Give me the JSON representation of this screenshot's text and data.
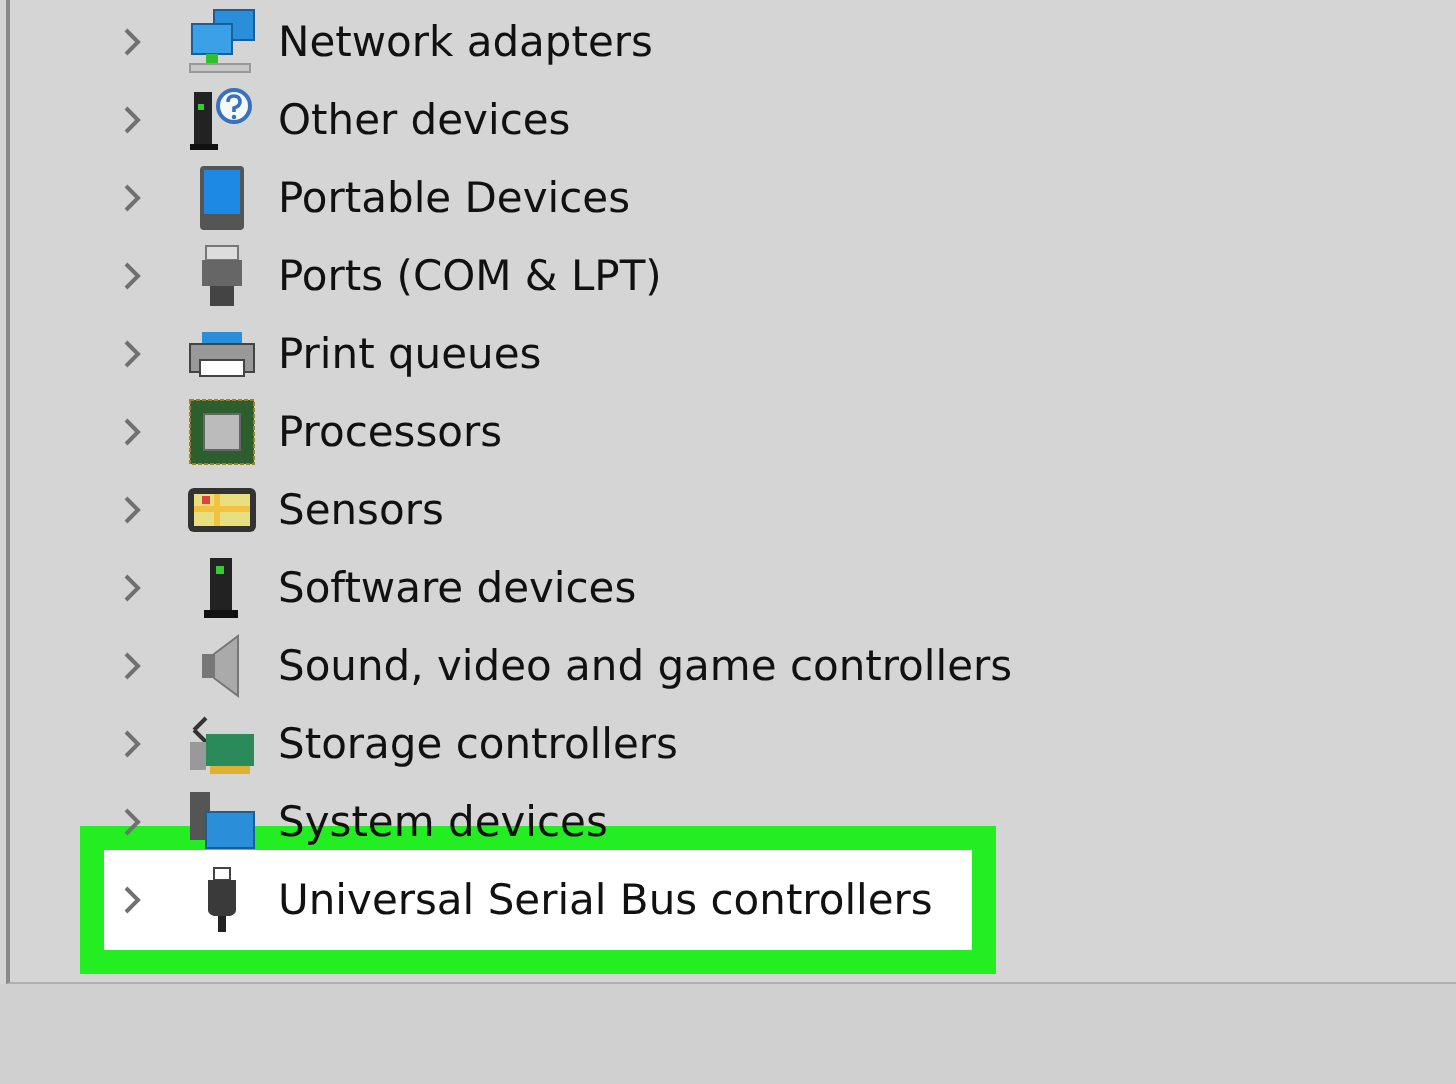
{
  "categories": [
    {
      "label": "Network adapters",
      "selected": false
    },
    {
      "label": "Other devices",
      "selected": false
    },
    {
      "label": "Portable Devices",
      "selected": false
    },
    {
      "label": "Ports (COM & LPT)",
      "selected": false
    },
    {
      "label": "Print queues",
      "selected": false
    },
    {
      "label": "Processors",
      "selected": false
    },
    {
      "label": "Sensors",
      "selected": false
    },
    {
      "label": "Software devices",
      "selected": false
    },
    {
      "label": "Sound, video and game controllers",
      "selected": false
    },
    {
      "label": "Storage controllers",
      "selected": false
    },
    {
      "label": "System devices",
      "selected": false
    },
    {
      "label": "Universal Serial Bus controllers",
      "selected": true
    }
  ]
}
